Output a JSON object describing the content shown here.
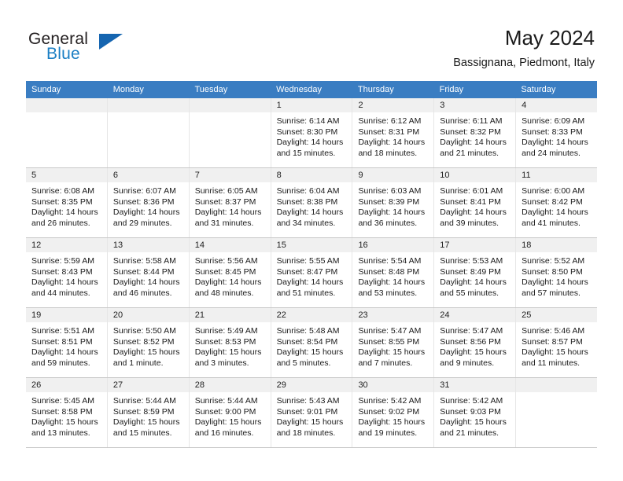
{
  "brand": {
    "line1": "General",
    "line2": "Blue",
    "logo_icon": "triangle-logo-icon",
    "accent_color": "#1b7fc4"
  },
  "header": {
    "title": "May 2024",
    "subtitle": "Bassignana, Piedmont, Italy"
  },
  "calendar": {
    "header_bg": "#3a7dc2",
    "weekdays": [
      "Sunday",
      "Monday",
      "Tuesday",
      "Wednesday",
      "Thursday",
      "Friday",
      "Saturday"
    ],
    "weeks": [
      [
        {
          "day": "",
          "sunrise": "",
          "sunset": "",
          "daylight": "",
          "daylight2": ""
        },
        {
          "day": "",
          "sunrise": "",
          "sunset": "",
          "daylight": "",
          "daylight2": ""
        },
        {
          "day": "",
          "sunrise": "",
          "sunset": "",
          "daylight": "",
          "daylight2": ""
        },
        {
          "day": "1",
          "sunrise": "Sunrise: 6:14 AM",
          "sunset": "Sunset: 8:30 PM",
          "daylight": "Daylight: 14 hours",
          "daylight2": "and 15 minutes."
        },
        {
          "day": "2",
          "sunrise": "Sunrise: 6:12 AM",
          "sunset": "Sunset: 8:31 PM",
          "daylight": "Daylight: 14 hours",
          "daylight2": "and 18 minutes."
        },
        {
          "day": "3",
          "sunrise": "Sunrise: 6:11 AM",
          "sunset": "Sunset: 8:32 PM",
          "daylight": "Daylight: 14 hours",
          "daylight2": "and 21 minutes."
        },
        {
          "day": "4",
          "sunrise": "Sunrise: 6:09 AM",
          "sunset": "Sunset: 8:33 PM",
          "daylight": "Daylight: 14 hours",
          "daylight2": "and 24 minutes."
        }
      ],
      [
        {
          "day": "5",
          "sunrise": "Sunrise: 6:08 AM",
          "sunset": "Sunset: 8:35 PM",
          "daylight": "Daylight: 14 hours",
          "daylight2": "and 26 minutes."
        },
        {
          "day": "6",
          "sunrise": "Sunrise: 6:07 AM",
          "sunset": "Sunset: 8:36 PM",
          "daylight": "Daylight: 14 hours",
          "daylight2": "and 29 minutes."
        },
        {
          "day": "7",
          "sunrise": "Sunrise: 6:05 AM",
          "sunset": "Sunset: 8:37 PM",
          "daylight": "Daylight: 14 hours",
          "daylight2": "and 31 minutes."
        },
        {
          "day": "8",
          "sunrise": "Sunrise: 6:04 AM",
          "sunset": "Sunset: 8:38 PM",
          "daylight": "Daylight: 14 hours",
          "daylight2": "and 34 minutes."
        },
        {
          "day": "9",
          "sunrise": "Sunrise: 6:03 AM",
          "sunset": "Sunset: 8:39 PM",
          "daylight": "Daylight: 14 hours",
          "daylight2": "and 36 minutes."
        },
        {
          "day": "10",
          "sunrise": "Sunrise: 6:01 AM",
          "sunset": "Sunset: 8:41 PM",
          "daylight": "Daylight: 14 hours",
          "daylight2": "and 39 minutes."
        },
        {
          "day": "11",
          "sunrise": "Sunrise: 6:00 AM",
          "sunset": "Sunset: 8:42 PM",
          "daylight": "Daylight: 14 hours",
          "daylight2": "and 41 minutes."
        }
      ],
      [
        {
          "day": "12",
          "sunrise": "Sunrise: 5:59 AM",
          "sunset": "Sunset: 8:43 PM",
          "daylight": "Daylight: 14 hours",
          "daylight2": "and 44 minutes."
        },
        {
          "day": "13",
          "sunrise": "Sunrise: 5:58 AM",
          "sunset": "Sunset: 8:44 PM",
          "daylight": "Daylight: 14 hours",
          "daylight2": "and 46 minutes."
        },
        {
          "day": "14",
          "sunrise": "Sunrise: 5:56 AM",
          "sunset": "Sunset: 8:45 PM",
          "daylight": "Daylight: 14 hours",
          "daylight2": "and 48 minutes."
        },
        {
          "day": "15",
          "sunrise": "Sunrise: 5:55 AM",
          "sunset": "Sunset: 8:47 PM",
          "daylight": "Daylight: 14 hours",
          "daylight2": "and 51 minutes."
        },
        {
          "day": "16",
          "sunrise": "Sunrise: 5:54 AM",
          "sunset": "Sunset: 8:48 PM",
          "daylight": "Daylight: 14 hours",
          "daylight2": "and 53 minutes."
        },
        {
          "day": "17",
          "sunrise": "Sunrise: 5:53 AM",
          "sunset": "Sunset: 8:49 PM",
          "daylight": "Daylight: 14 hours",
          "daylight2": "and 55 minutes."
        },
        {
          "day": "18",
          "sunrise": "Sunrise: 5:52 AM",
          "sunset": "Sunset: 8:50 PM",
          "daylight": "Daylight: 14 hours",
          "daylight2": "and 57 minutes."
        }
      ],
      [
        {
          "day": "19",
          "sunrise": "Sunrise: 5:51 AM",
          "sunset": "Sunset: 8:51 PM",
          "daylight": "Daylight: 14 hours",
          "daylight2": "and 59 minutes."
        },
        {
          "day": "20",
          "sunrise": "Sunrise: 5:50 AM",
          "sunset": "Sunset: 8:52 PM",
          "daylight": "Daylight: 15 hours",
          "daylight2": "and 1 minute."
        },
        {
          "day": "21",
          "sunrise": "Sunrise: 5:49 AM",
          "sunset": "Sunset: 8:53 PM",
          "daylight": "Daylight: 15 hours",
          "daylight2": "and 3 minutes."
        },
        {
          "day": "22",
          "sunrise": "Sunrise: 5:48 AM",
          "sunset": "Sunset: 8:54 PM",
          "daylight": "Daylight: 15 hours",
          "daylight2": "and 5 minutes."
        },
        {
          "day": "23",
          "sunrise": "Sunrise: 5:47 AM",
          "sunset": "Sunset: 8:55 PM",
          "daylight": "Daylight: 15 hours",
          "daylight2": "and 7 minutes."
        },
        {
          "day": "24",
          "sunrise": "Sunrise: 5:47 AM",
          "sunset": "Sunset: 8:56 PM",
          "daylight": "Daylight: 15 hours",
          "daylight2": "and 9 minutes."
        },
        {
          "day": "25",
          "sunrise": "Sunrise: 5:46 AM",
          "sunset": "Sunset: 8:57 PM",
          "daylight": "Daylight: 15 hours",
          "daylight2": "and 11 minutes."
        }
      ],
      [
        {
          "day": "26",
          "sunrise": "Sunrise: 5:45 AM",
          "sunset": "Sunset: 8:58 PM",
          "daylight": "Daylight: 15 hours",
          "daylight2": "and 13 minutes."
        },
        {
          "day": "27",
          "sunrise": "Sunrise: 5:44 AM",
          "sunset": "Sunset: 8:59 PM",
          "daylight": "Daylight: 15 hours",
          "daylight2": "and 15 minutes."
        },
        {
          "day": "28",
          "sunrise": "Sunrise: 5:44 AM",
          "sunset": "Sunset: 9:00 PM",
          "daylight": "Daylight: 15 hours",
          "daylight2": "and 16 minutes."
        },
        {
          "day": "29",
          "sunrise": "Sunrise: 5:43 AM",
          "sunset": "Sunset: 9:01 PM",
          "daylight": "Daylight: 15 hours",
          "daylight2": "and 18 minutes."
        },
        {
          "day": "30",
          "sunrise": "Sunrise: 5:42 AM",
          "sunset": "Sunset: 9:02 PM",
          "daylight": "Daylight: 15 hours",
          "daylight2": "and 19 minutes."
        },
        {
          "day": "31",
          "sunrise": "Sunrise: 5:42 AM",
          "sunset": "Sunset: 9:03 PM",
          "daylight": "Daylight: 15 hours",
          "daylight2": "and 21 minutes."
        },
        {
          "day": "",
          "sunrise": "",
          "sunset": "",
          "daylight": "",
          "daylight2": ""
        }
      ]
    ]
  }
}
